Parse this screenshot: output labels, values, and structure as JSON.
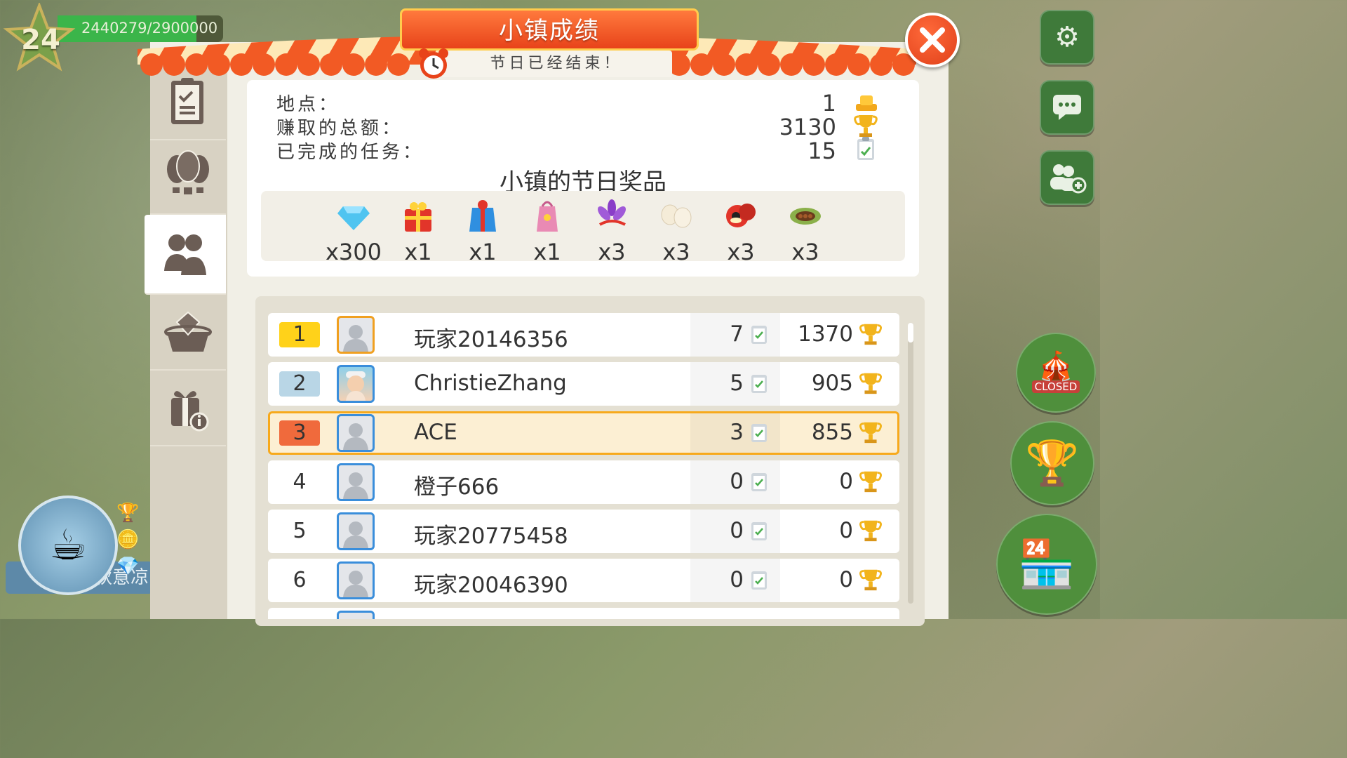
{
  "hud": {
    "level": "24",
    "xp_text": "2440279/2900000",
    "xp_progress": 0.841,
    "cafe_name": "秋意凉"
  },
  "header": {
    "title": "小镇成绩",
    "subtitle": "节日已经结束！"
  },
  "sidebar": {
    "tabs": [
      {
        "name": "tasks",
        "icon": "clipboard-icon"
      },
      {
        "name": "balloons",
        "icon": "hot-air-balloon-icon"
      },
      {
        "name": "community",
        "icon": "people-icon",
        "active": true
      },
      {
        "name": "treasure",
        "icon": "diamond-basket-icon"
      },
      {
        "name": "gift-info",
        "icon": "gift-info-icon"
      }
    ]
  },
  "stats": {
    "place_label": "地点：",
    "place_value": "1",
    "earned_label": "赚取的总额：",
    "earned_value": "3130",
    "tasks_label": "已完成的任务：",
    "tasks_value": "15"
  },
  "prizes": {
    "title": "小镇的节日奖品",
    "items": [
      {
        "icon": "diamond-icon",
        "qty": "x300"
      },
      {
        "icon": "gift-box-red-icon",
        "qty": "x1"
      },
      {
        "icon": "gift-box-blue-icon",
        "qty": "x1"
      },
      {
        "icon": "gift-bag-pink-icon",
        "qty": "x1"
      },
      {
        "icon": "saffron-flower-icon",
        "qty": "x3"
      },
      {
        "icon": "eggs-icon",
        "qty": "x3"
      },
      {
        "icon": "ackee-fruit-icon",
        "qty": "x3"
      },
      {
        "icon": "cocoa-pod-icon",
        "qty": "x3"
      }
    ]
  },
  "leaderboard": [
    {
      "rank": "1",
      "name": "玩家20146356",
      "tasks": "7",
      "score": "1370"
    },
    {
      "rank": "2",
      "name": "ChristieZhang",
      "tasks": "5",
      "score": "905"
    },
    {
      "rank": "3",
      "name": "ACE",
      "tasks": "3",
      "score": "855",
      "is_me": true
    },
    {
      "rank": "4",
      "name": "橙子666",
      "tasks": "0",
      "score": "0"
    },
    {
      "rank": "5",
      "name": "玩家20775458",
      "tasks": "0",
      "score": "0"
    },
    {
      "rank": "6",
      "name": "玩家20046390",
      "tasks": "0",
      "score": "0"
    }
  ],
  "right_hud": {
    "closed_label": "CLOSED"
  },
  "colors": {
    "rank1": "#ffd21a",
    "rank2": "#b9d6e6",
    "rank3": "#f06a3c",
    "highlight_border": "#f7a91c",
    "title_red": "#e8431a"
  }
}
